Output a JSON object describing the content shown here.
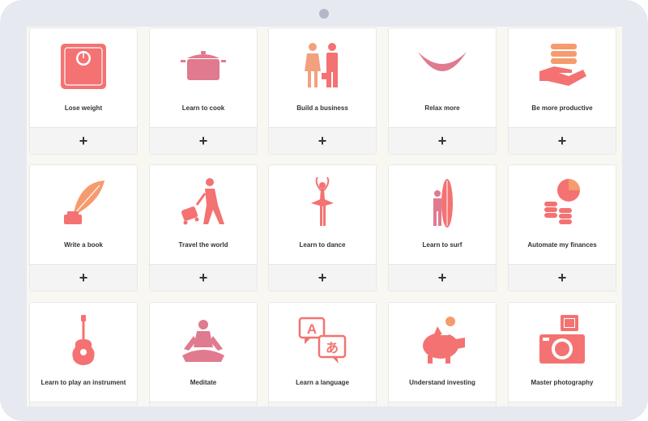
{
  "accent_colors": {
    "coral": "#f47272",
    "pink": "#e07a8f",
    "peach": "#f3a07e",
    "orange": "#f69b6e"
  },
  "goals": [
    {
      "label": "Lose weight",
      "icon": "scale-icon",
      "action": "+"
    },
    {
      "label": "Learn to cook",
      "icon": "cooking-pot-icon",
      "action": "+"
    },
    {
      "label": "Build a business",
      "icon": "business-people-icon",
      "action": "+"
    },
    {
      "label": "Relax more",
      "icon": "hammock-icon",
      "action": "+"
    },
    {
      "label": "Be more productive",
      "icon": "hand-coins-icon",
      "action": "+"
    },
    {
      "label": "Write a book",
      "icon": "quill-inkwell-icon",
      "action": "+"
    },
    {
      "label": "Travel the world",
      "icon": "traveler-suitcase-icon",
      "action": "+"
    },
    {
      "label": "Learn to dance",
      "icon": "ballerina-icon",
      "action": "+"
    },
    {
      "label": "Learn to surf",
      "icon": "surfer-board-icon",
      "action": "+"
    },
    {
      "label": "Automate my finances",
      "icon": "coin-stacks-icon",
      "action": "+"
    },
    {
      "label": "Learn to play an instrument",
      "icon": "guitar-icon",
      "action": "+"
    },
    {
      "label": "Meditate",
      "icon": "meditation-icon",
      "action": "+"
    },
    {
      "label": "Learn a language",
      "icon": "translation-bubbles-icon",
      "action": "+"
    },
    {
      "label": "Understand investing",
      "icon": "piggy-bank-icon",
      "action": "+"
    },
    {
      "label": "Master photography",
      "icon": "camera-icon",
      "action": "+"
    }
  ]
}
